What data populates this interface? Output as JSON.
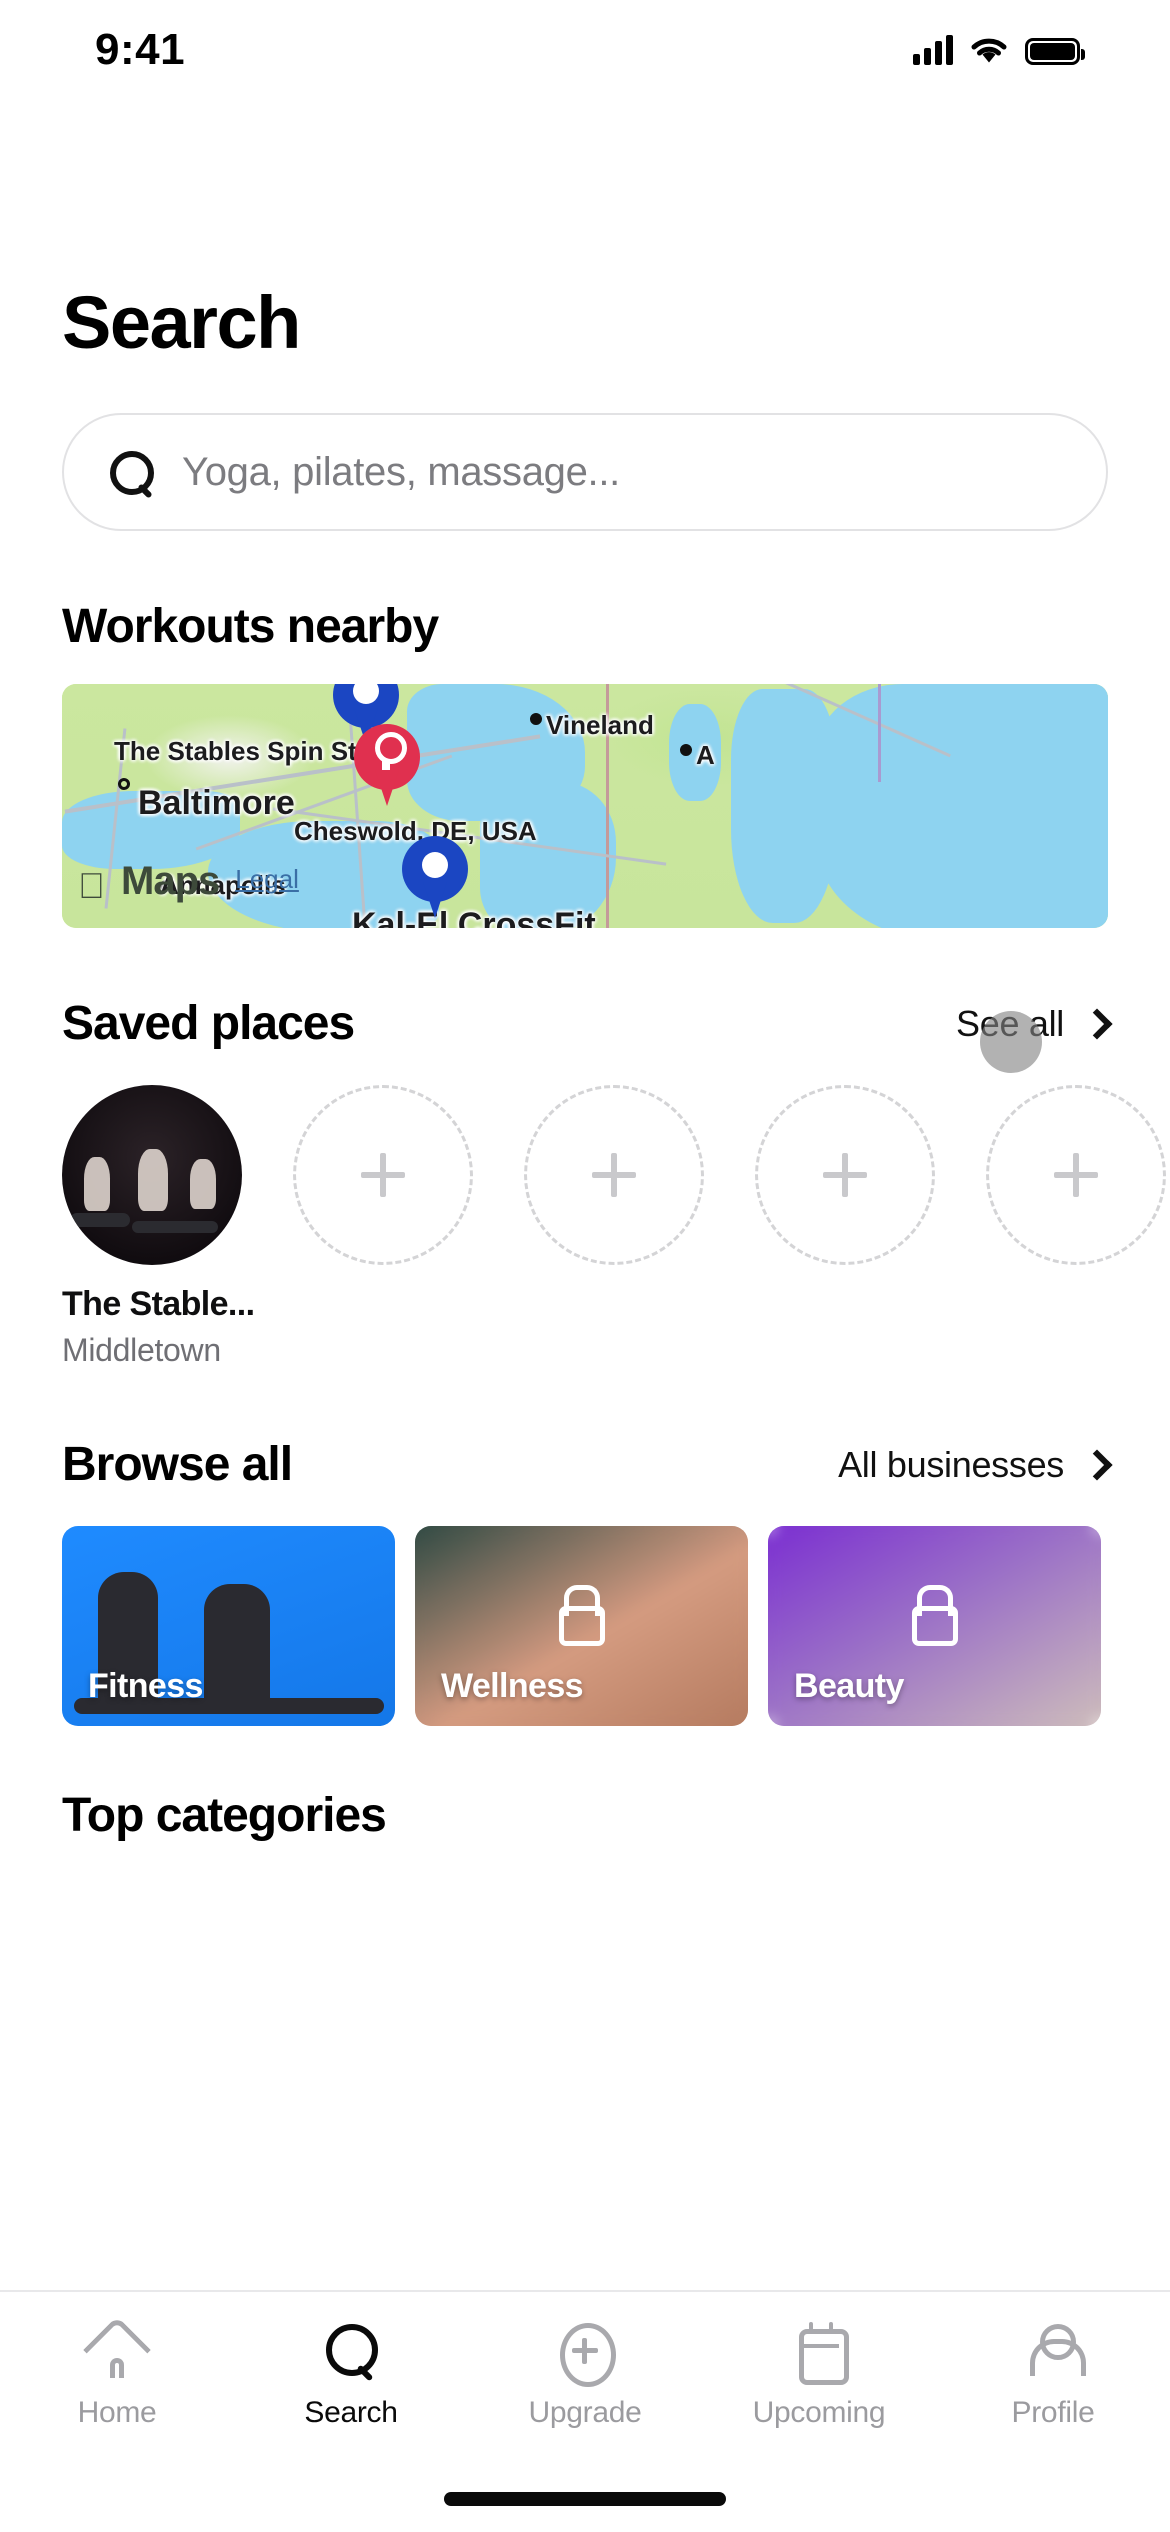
{
  "status_bar": {
    "time": "9:41",
    "signal_icon": "cellular-signal-icon",
    "wifi_icon": "wifi-icon",
    "battery_icon": "battery-icon"
  },
  "header": {
    "title": "Search"
  },
  "search": {
    "icon": "search-icon",
    "placeholder": "Yoga, pilates, massage...",
    "value": ""
  },
  "workouts_nearby": {
    "title": "Workouts nearby",
    "map": {
      "provider": "Maps",
      "apple_logo": "",
      "legal_link": "Legal",
      "labels": [
        {
          "text": "The Stables Spin Studio",
          "kind": "poi"
        },
        {
          "text": "Baltimore",
          "kind": "city"
        },
        {
          "text": "Cheswold, DE, USA",
          "kind": "place"
        },
        {
          "text": "Vineland",
          "kind": "city"
        },
        {
          "text": "A",
          "kind": "city"
        },
        {
          "text": "Annapolis",
          "kind": "city"
        },
        {
          "text": "Kal-El CrossFit",
          "kind": "poi"
        }
      ],
      "pins": [
        {
          "name": "The Stables Spin Studio",
          "color": "#1b46c2",
          "type": "saved"
        },
        {
          "name": "Cheswold, DE, USA",
          "color": "#e0304f",
          "type": "selected"
        },
        {
          "name": "Kal-El CrossFit",
          "color": "#1b46c2",
          "type": "saved"
        }
      ]
    }
  },
  "saved_places": {
    "title": "Saved places",
    "see_all_label": "See all",
    "see_all_icon": "chevron-right-icon",
    "items": [
      {
        "name": "The Stable...",
        "location": "Middletown",
        "has_photo": true
      },
      {
        "name": "",
        "location": "",
        "has_photo": false,
        "add_icon": "plus-icon"
      },
      {
        "name": "",
        "location": "",
        "has_photo": false,
        "add_icon": "plus-icon"
      },
      {
        "name": "",
        "location": "",
        "has_photo": false,
        "add_icon": "plus-icon"
      },
      {
        "name": "",
        "location": "",
        "has_photo": false,
        "add_icon": "plus-icon"
      }
    ]
  },
  "browse_all": {
    "title": "Browse all",
    "link_label": "All businesses",
    "link_icon": "chevron-right-icon",
    "cards": [
      {
        "label": "Fitness",
        "locked": false,
        "accent": "#1f8bff"
      },
      {
        "label": "Wellness",
        "locked": true,
        "lock_icon": "lock-icon",
        "accent": "#b87a5e"
      },
      {
        "label": "Beauty",
        "locked": true,
        "lock_icon": "lock-icon",
        "accent": "#7b2fd1"
      }
    ]
  },
  "top_categories": {
    "title": "Top categories"
  },
  "tab_bar": {
    "items": [
      {
        "label": "Home",
        "icon": "home-icon",
        "active": false
      },
      {
        "label": "Search",
        "icon": "search-icon",
        "active": true
      },
      {
        "label": "Upgrade",
        "icon": "plus-circle-icon",
        "active": false
      },
      {
        "label": "Upcoming",
        "icon": "calendar-icon",
        "active": false
      },
      {
        "label": "Profile",
        "icon": "person-icon",
        "active": false
      }
    ]
  },
  "home_indicator": {
    "icon": "home-indicator"
  }
}
